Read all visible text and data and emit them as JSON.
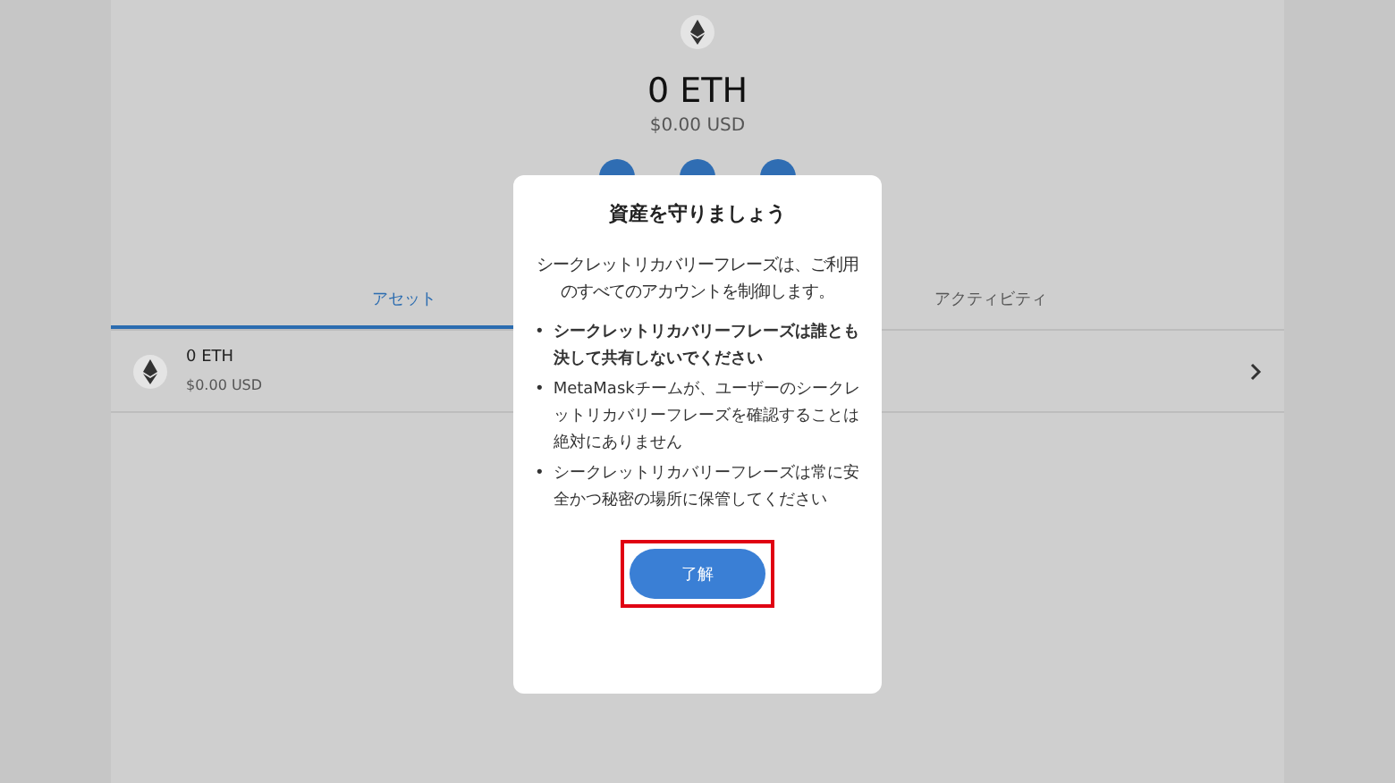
{
  "balance": {
    "amount": "0 ETH",
    "fiat": "$0.00 USD"
  },
  "action_buttons": [
    {
      "kind": "circle"
    },
    {
      "kind": "circle"
    },
    {
      "kind": "circle"
    }
  ],
  "tabs": [
    {
      "label": "アセット",
      "selected": true
    },
    {
      "label": "アクティビティ",
      "selected": false
    }
  ],
  "assets": [
    {
      "name": "0 ETH",
      "fiat": "$0.00 USD"
    }
  ],
  "modal": {
    "title": "資産を守りましょう",
    "intro": "シークレットリカバリーフレーズは、ご利用のすべてのアカウントを制御します。",
    "bullet_marker": "•",
    "bullets": [
      {
        "text": "シークレットリカバリーフレーズは誰とも決して共有しないでください",
        "bold": true
      },
      {
        "text": "MetaMaskチームが、ユーザーのシークレットリカバリーフレーズを確認することは絶対にありません",
        "bold": false
      },
      {
        "text": "シークレットリカバリーフレーズは常に安全かつ秘密の場所に保管してください",
        "bold": false
      }
    ],
    "button": {
      "label": "了解",
      "highlighted": true
    }
  }
}
